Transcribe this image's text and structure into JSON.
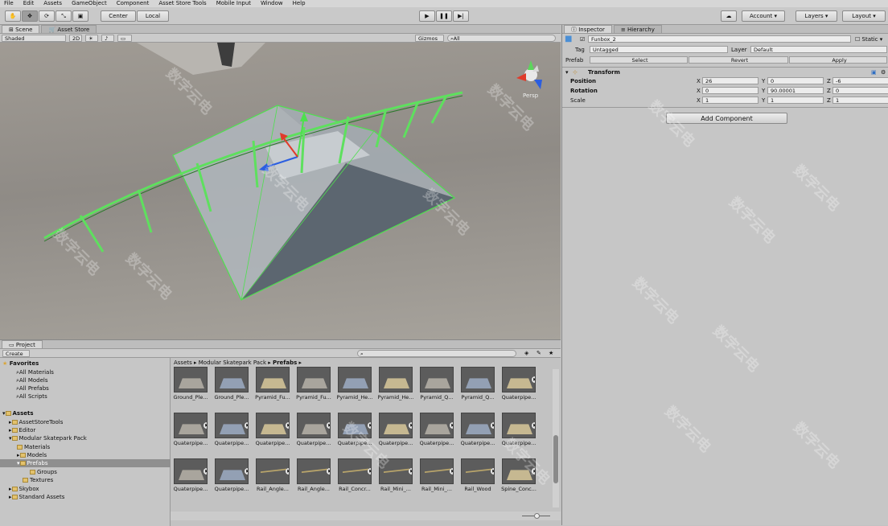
{
  "menu": [
    "File",
    "Edit",
    "Assets",
    "GameObject",
    "Component",
    "Asset Store Tools",
    "Mobile Input",
    "Window",
    "Help"
  ],
  "toolbar": {
    "center": "Center",
    "local": "Local",
    "account": "Account",
    "layers": "Layers",
    "layout": "Layout"
  },
  "scene": {
    "tab_scene": "Scene",
    "tab_store": "Asset Store",
    "shaded": "Shaded",
    "mode2d": "2D",
    "gizmos": "Gizmos",
    "search": "All",
    "persp": "Persp"
  },
  "inspector": {
    "tab": "Inspector",
    "tab2": "Hierarchy",
    "object_name": "Funbox_2",
    "static": "Static",
    "tag_label": "Tag",
    "tag": "Untagged",
    "layer_label": "Layer",
    "layer": "Default",
    "prefab_label": "Prefab",
    "select": "Select",
    "revert": "Revert",
    "apply": "Apply",
    "transform": "Transform",
    "position_label": "Position",
    "rotation_label": "Rotation",
    "scale_label": "Scale",
    "x": "X",
    "y": "Y",
    "z": "Z",
    "position": {
      "x": "26",
      "y": "0",
      "z": "-6"
    },
    "rotation": {
      "x": "0",
      "y": "90.00001",
      "z": "0"
    },
    "scale": {
      "x": "1",
      "y": "1",
      "z": "1"
    },
    "add_component": "Add Component"
  },
  "project": {
    "tab": "Project",
    "create": "Create",
    "breadcrumb": [
      "Assets",
      "Modular Skatepark Pack",
      "Prefabs"
    ],
    "favorites": "Favorites",
    "fav_items": [
      "All Materials",
      "All Models",
      "All Prefabs",
      "All Scripts"
    ],
    "assets": "Assets",
    "tree": [
      "AssetStoreTools",
      "Editor",
      "Modular Skatepark Pack",
      "Materials",
      "Models",
      "Prefabs",
      "Groups",
      "Textures",
      "Skybox",
      "Standard Assets"
    ],
    "items": [
      "Ground_Ple...",
      "Ground_Ple...",
      "Pyramid_Fu...",
      "Pyramid_Fu...",
      "Pyramid_He...",
      "Pyramid_He...",
      "Pyramid_Q...",
      "Pyramid_Q...",
      "Quaterpipe...",
      "Quaterpipe...",
      "Quaterpipe...",
      "Quaterpipe...",
      "Quaterpipe...",
      "Quaterpipe...",
      "Quaterpipe...",
      "Quaterpipe...",
      "Quaterpipe...",
      "Quaterpipe...",
      "Quaterpipe...",
      "Quaterpipe...",
      "Rail_Angle...",
      "Rail_Angle...",
      "Rail_Concr...",
      "Rail_Mini_...",
      "Rail_Mini_...",
      "Rail_Wood",
      "Spine_Conc..."
    ]
  },
  "watermark": "数字云电"
}
